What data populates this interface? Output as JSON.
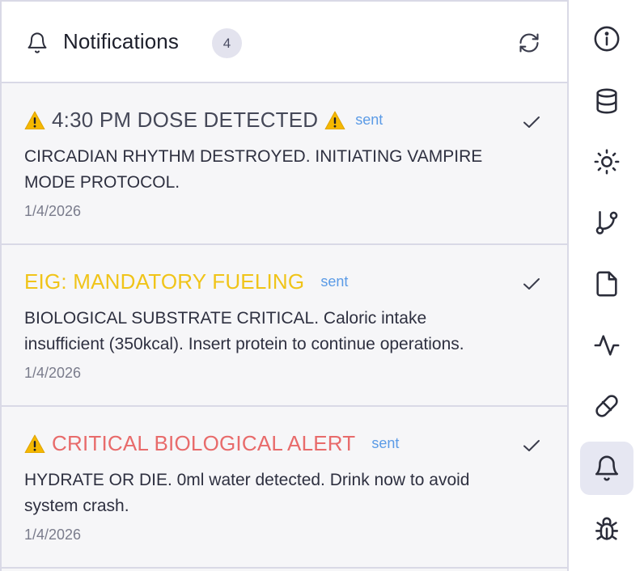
{
  "header": {
    "title": "Notifications",
    "count": "4"
  },
  "notifications": [
    {
      "title": "4:30 PM DOSE DETECTED",
      "title_color": "#454858",
      "warning_left": true,
      "warning_right": true,
      "status": "sent",
      "body": "CIRCADIAN RHYTHM DESTROYED. INITIATING VAMPIRE MODE PROTOCOL.",
      "date": "1/4/2026"
    },
    {
      "title": "EIG: MANDATORY FUELING",
      "title_color": "#f0c419",
      "warning_left": false,
      "warning_right": false,
      "status": "sent",
      "body": "BIOLOGICAL SUBSTRATE CRITICAL. Caloric intake insufficient (350kcal). Insert protein to continue operations.",
      "date": "1/4/2026"
    },
    {
      "title": "CRITICAL BIOLOGICAL ALERT",
      "title_color": "#e86b6b",
      "warning_left": true,
      "warning_right": false,
      "status": "sent",
      "body": "HYDRATE OR DIE. 0ml water detected. Drink now to avoid system crash.",
      "date": "1/4/2026"
    }
  ],
  "rail": {
    "items": [
      {
        "icon": "info-icon",
        "active": false
      },
      {
        "icon": "database-icon",
        "active": false
      },
      {
        "icon": "sun-icon",
        "active": false
      },
      {
        "icon": "git-branch-icon",
        "active": false
      },
      {
        "icon": "file-icon",
        "active": false
      },
      {
        "icon": "activity-icon",
        "active": false
      },
      {
        "icon": "pill-icon",
        "active": false
      },
      {
        "icon": "bell-icon",
        "active": true
      },
      {
        "icon": "bug-icon",
        "active": false
      }
    ]
  },
  "colors": {
    "accent_sent": "#5b9be6",
    "warning": "#f5b800",
    "active_rail": "#e6e7f2"
  }
}
